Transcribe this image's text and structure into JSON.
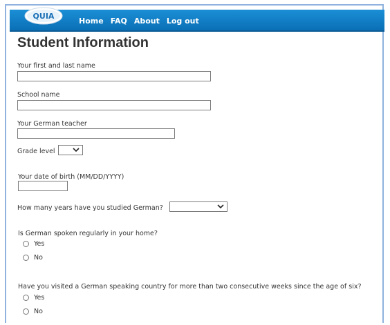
{
  "nav": {
    "logo_text": "QUIA",
    "links": [
      "Home",
      "FAQ",
      "About",
      "Log out"
    ]
  },
  "page": {
    "title": "Student Information"
  },
  "form": {
    "name_label": "Your first and last name",
    "name_value": "",
    "school_label": "School name",
    "school_value": "",
    "teacher_label": "Your German teacher",
    "teacher_value": "",
    "grade_label": "Grade level",
    "grade_value": "",
    "dob_label": "Your date of birth (MM/DD/YYYY)",
    "dob_value": "",
    "years_label": "How many years have you studied German?",
    "years_value": "",
    "home_question": "Is German spoken regularly in your home?",
    "visit_question": "Have you visited a German speaking country for more than two consecutive weeks since the age of six?",
    "yes": "Yes",
    "no": "No"
  },
  "colors": {
    "nav_blue": "#0a6fb5",
    "frame_border": "#8fb2df",
    "text": "#333333"
  }
}
